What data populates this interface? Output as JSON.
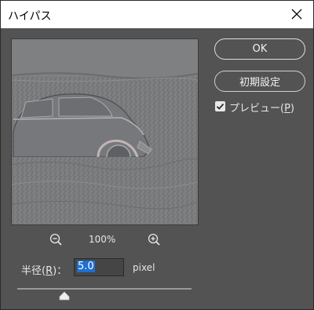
{
  "window": {
    "title": "ハイパス"
  },
  "zoom": {
    "level": "100%"
  },
  "radius": {
    "label_prefix": "半径(",
    "label_key": "R",
    "label_suffix": ")：",
    "value": "5.0",
    "unit": "pixel",
    "slider_fraction": 0.27
  },
  "buttons": {
    "ok": "OK",
    "reset": "初期設定"
  },
  "preview_option": {
    "label_prefix": "プレビュー(",
    "label_key": "P",
    "label_suffix": ")",
    "checked": true
  },
  "icons": {
    "close": "close-icon",
    "zoom_out": "zoom-out-icon",
    "zoom_in": "zoom-in-icon",
    "checkmark": "checkmark-icon"
  },
  "colors": {
    "dialog_bg": "#535353",
    "titlebar_bg": "#ffffff",
    "selection": "#1e6fd0"
  }
}
